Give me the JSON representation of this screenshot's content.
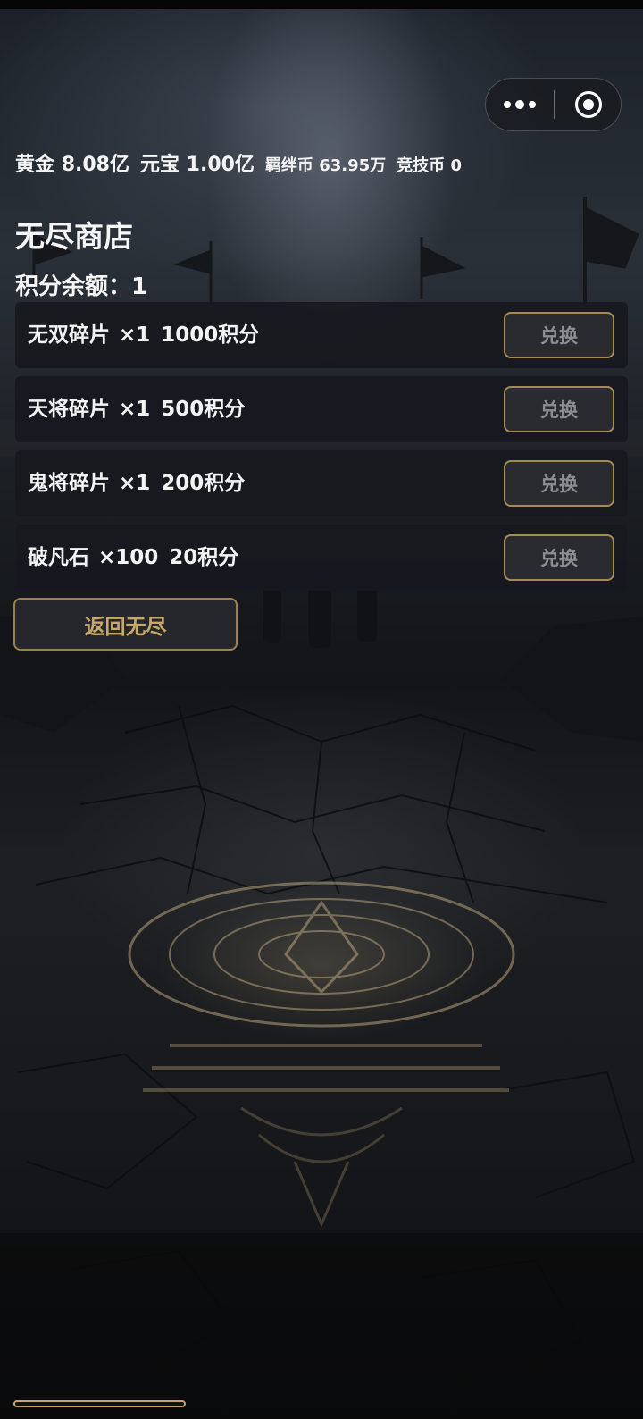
{
  "currency": {
    "gold_label": "黄金",
    "gold_value": "8.08亿",
    "yuanbao_label": "元宝",
    "yuanbao_value": "1.00亿",
    "jiban_label": "羁绊币",
    "jiban_value": "63.95万",
    "jingji_label": "竞技币",
    "jingji_value": "0"
  },
  "shop": {
    "title": "无尽商店",
    "balance_text": "积分余额：1",
    "items": [
      {
        "name": "无双碎片",
        "qty": "×1",
        "cost": "1000积分",
        "button": "兑换"
      },
      {
        "name": "天将碎片",
        "qty": "×1",
        "cost": "500积分",
        "button": "兑换"
      },
      {
        "name": "鬼将碎片",
        "qty": "×1",
        "cost": "200积分",
        "button": "兑换"
      },
      {
        "name": "破凡石",
        "qty": "×100",
        "cost": "20积分",
        "button": "兑换"
      }
    ],
    "back_button": "返回无尽"
  },
  "capsule": {
    "more_icon": "more-dots-icon",
    "close_icon": "target-close-icon"
  },
  "colors": {
    "accent_gold": "#a58a52",
    "back_text": "#c9a96a"
  }
}
